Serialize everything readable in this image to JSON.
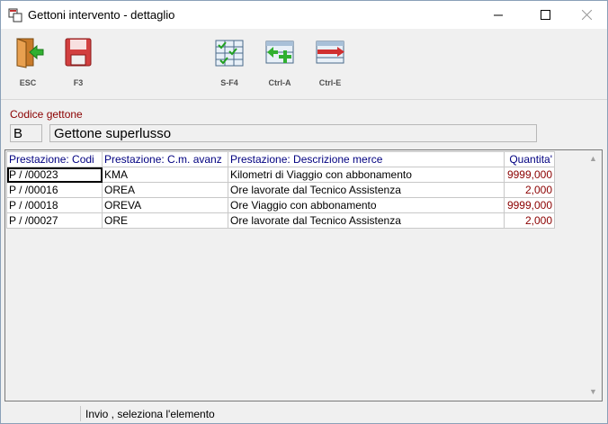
{
  "window": {
    "title": "Gettoni intervento - dettaglio"
  },
  "toolbar": {
    "esc_label": "ESC",
    "f3_label": "F3",
    "sf4_label": "S-F4",
    "ctrla_label": "Ctrl-A",
    "ctrle_label": "Ctrl-E"
  },
  "form": {
    "codice_label": "Codice gettone",
    "codice_value": "B",
    "descrizione_value": "Gettone superlusso"
  },
  "grid": {
    "columns": [
      "Prestazione: Codi",
      "Prestazione: C.m. avanz",
      "Prestazione: Descrizione merce",
      "Quantita'"
    ],
    "rows": [
      {
        "codice": "P / /00023",
        "cm": "KMA",
        "descrizione": "Kilometri di Viaggio con abbonamento",
        "quantita": "9999,000"
      },
      {
        "codice": "P / /00016",
        "cm": "OREA",
        "descrizione": "Ore lavorate dal Tecnico Assistenza",
        "quantita": "2,000"
      },
      {
        "codice": "P / /00018",
        "cm": "OREVA",
        "descrizione": "Ore Viaggio con abbonamento",
        "quantita": "9999,000"
      },
      {
        "codice": "P / /00027",
        "cm": "ORE",
        "descrizione": "Ore lavorate dal Tecnico Assistenza",
        "quantita": "2,000"
      }
    ]
  },
  "status": {
    "text": "Invio , seleziona l'elemento"
  }
}
